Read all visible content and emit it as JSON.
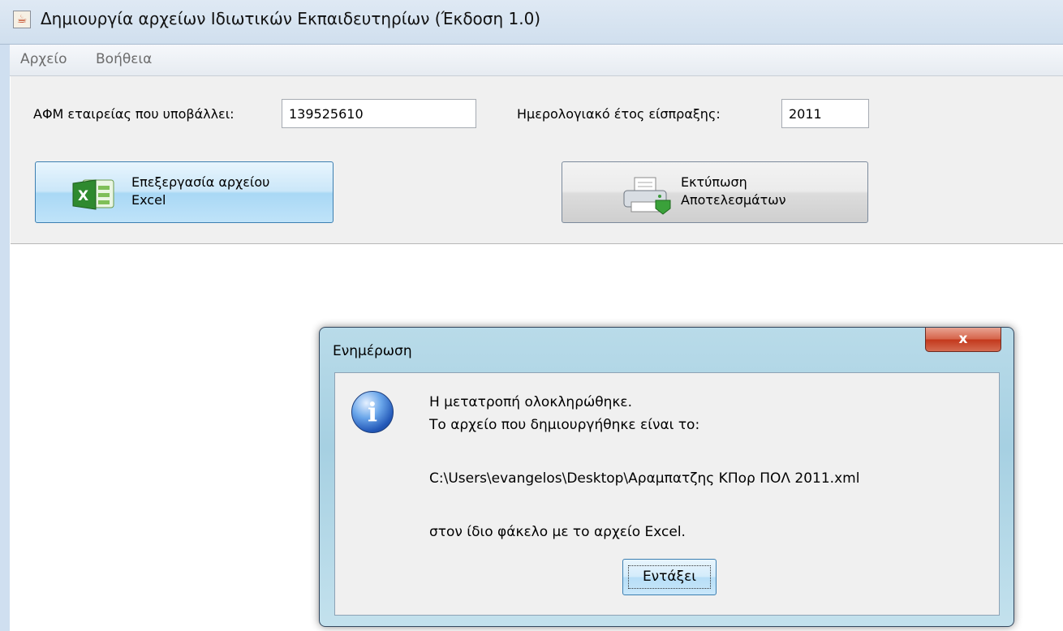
{
  "window": {
    "title": "Δημιουργία αρχείων Ιδιωτικών Εκπαιδευτηρίων (Έκδοση 1.0)",
    "app_icon": "java-cup-icon"
  },
  "menu": {
    "items": [
      {
        "label": "Αρχείο"
      },
      {
        "label": "Βοήθεια"
      }
    ]
  },
  "form": {
    "afm_label": "ΑΦΜ εταιρείας που υποβάλλει:",
    "afm_value": "139525610",
    "year_label": "Ημερολογιακό έτος είσπραξης:",
    "year_value": "2011"
  },
  "buttons": {
    "excel": {
      "line1": "Επεξεργασία αρχείου",
      "line2": "Excel",
      "icon": "excel-icon"
    },
    "print": {
      "line1": "Εκτύπωση",
      "line2": "Αποτελεσμάτων",
      "icon": "printer-icon"
    }
  },
  "dialog": {
    "title": "Ενημέρωση",
    "close_label": "x",
    "icon": "info-icon",
    "line1": "Η μετατροπή ολοκληρώθηκε.",
    "line2": "Το αρχείο που δημιουργήθηκε είναι το:",
    "path": "C:\\Users\\evangelos\\Desktop\\Αραμπατζης ΚΠορ ΠΟΛ 2011.xml",
    "line3": "στον ίδιο φάκελο με το αρχείο Excel.",
    "ok_label": "Εντάξει"
  },
  "colors": {
    "accent_button": "#a9d8f5",
    "close_button": "#c3391d",
    "info_icon": "#2358b8"
  }
}
